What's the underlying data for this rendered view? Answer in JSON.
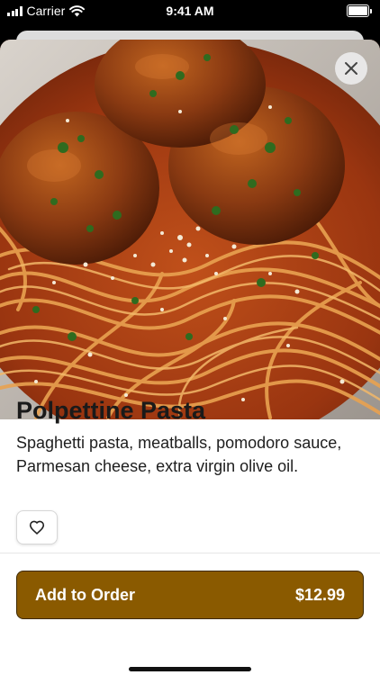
{
  "status_bar": {
    "carrier": "Carrier",
    "time": "9:41 AM",
    "icons": [
      "signal-icon",
      "wifi-icon",
      "battery-icon"
    ]
  },
  "item": {
    "title": "Polpettine Pasta",
    "description": "Spaghetti pasta, meatballs, pomodoro sauce, Parmesan cheese, extra virgin olive oil.",
    "image_alt": "Spaghetti with meatballs, pomodoro sauce and grated Parmesan"
  },
  "actions": {
    "close_icon": "close-icon",
    "favorite_icon": "heart-outline-icon",
    "add_to_order_label": "Add to Order",
    "price": "$12.99"
  },
  "colors": {
    "accent": "#8a5a00",
    "accent_border": "#3d2800",
    "background": "#ffffff"
  }
}
